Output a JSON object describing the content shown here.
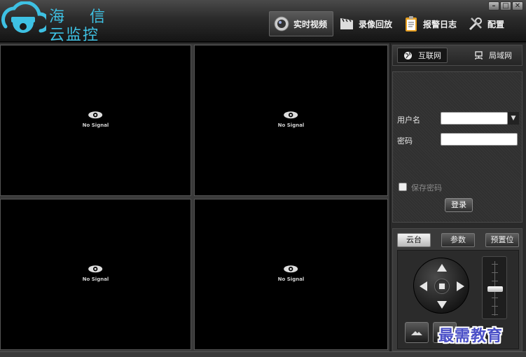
{
  "app": {
    "logo_line1_left": "海",
    "logo_line1_right": "信",
    "logo_line2": "云监控",
    "accent": "#3ec1e3"
  },
  "nav": {
    "tabs": [
      {
        "label": "实时视频",
        "icon": "camera-lens-icon",
        "active": true
      },
      {
        "label": "录像回放",
        "icon": "film-clapper-icon",
        "active": false
      },
      {
        "label": "报警日志",
        "icon": "clipboard-icon",
        "active": false
      },
      {
        "label": "配置",
        "icon": "tools-icon",
        "active": false
      }
    ]
  },
  "window_controls": {
    "minimize": "–",
    "maximize": "□",
    "close": "✕"
  },
  "video": {
    "cells": [
      {
        "status": "No Signal"
      },
      {
        "status": "No Signal"
      },
      {
        "status": "No Signal"
      },
      {
        "status": "No Signal"
      }
    ]
  },
  "network_tabs": [
    {
      "label": "互联网",
      "icon": "globe-icon",
      "active": true
    },
    {
      "label": "局域网",
      "icon": "lan-icon",
      "active": false
    }
  ],
  "login": {
    "username_label": "用户名",
    "username_value": "",
    "password_label": "密码",
    "password_value": "",
    "remember_label": "保存密码",
    "remember_checked": false,
    "login_button": "登录"
  },
  "ptz": {
    "tabs": [
      {
        "label": "云台",
        "active": true
      },
      {
        "label": "参数",
        "active": false
      },
      {
        "label": "预置位",
        "active": false
      }
    ]
  },
  "watermark": "最需教育"
}
